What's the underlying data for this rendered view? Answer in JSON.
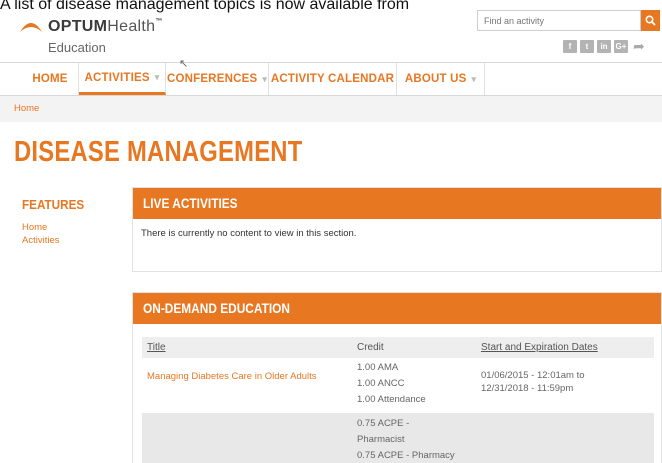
{
  "caption": "A list of disease management topics is now available from",
  "logo": {
    "brand_bold": "OPTUM",
    "brand_light": "Health",
    "trademark": "™",
    "subtitle": "Education"
  },
  "search": {
    "placeholder": "Find an activity"
  },
  "social": {
    "facebook": "f",
    "twitter": "t",
    "linkedin": "in",
    "googleplus": "G+",
    "share": "➦"
  },
  "nav": {
    "home": "HOME",
    "activities": "ACTIVITIES",
    "conferences": "CONFERENCES",
    "calendar": "ACTIVITY CALENDAR",
    "about": "ABOUT US",
    "caret": "▾"
  },
  "breadcrumb": {
    "home": "Home"
  },
  "page_title": "DISEASE MANAGEMENT",
  "features": {
    "heading": "FEATURES",
    "items": [
      "Home",
      "Activities"
    ]
  },
  "live": {
    "title": "LIVE ACTIVITIES",
    "message": "There is currently no content to view in this section."
  },
  "ondemand": {
    "title": "ON-DEMAND EDUCATION",
    "columns": {
      "title": "Title",
      "credit": "Credit",
      "dates": "Start and Expiration Dates"
    },
    "rows": [
      {
        "title": "Managing Diabetes Care in Older Adults",
        "credits": [
          "1.00 AMA",
          "1.00 ANCC",
          "1.00 Attendance"
        ],
        "dates": "01/06/2015 - 12:01am to 12/31/2018 - 11:59pm"
      },
      {
        "title": "",
        "credits": [
          "0.75 ACPE -",
          "Pharmacist",
          "0.75 ACPE - Pharmacy"
        ],
        "dates": ""
      }
    ]
  },
  "colors": {
    "accent": "#e87722",
    "panel_border": "#e2e2e2",
    "table_header": "#eeeeee"
  }
}
